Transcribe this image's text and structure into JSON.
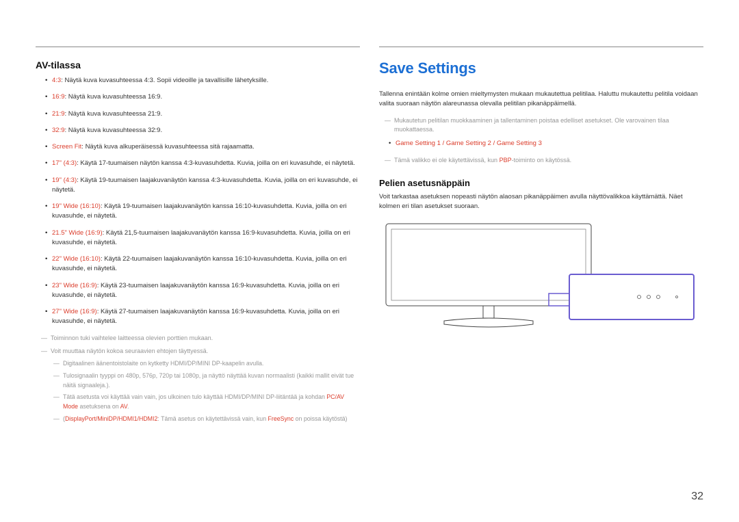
{
  "left": {
    "title": "AV-tilassa",
    "items": [
      {
        "term": "4:3",
        "rest": ": Näytä kuva kuvasuhteessa 4:3. Sopii videoille ja tavallisille lähetyksille."
      },
      {
        "term": "16:9",
        "rest": ": Näytä kuva kuvasuhteessa 16:9."
      },
      {
        "term": "21:9",
        "rest": ": Näytä kuva kuvasuhteessa 21:9."
      },
      {
        "term": "32:9",
        "rest": ": Näytä kuva kuvasuhteessa 32:9."
      },
      {
        "term": "Screen Fit",
        "rest": ": Näytä kuva alkuperäisessä kuvasuhteessa sitä rajaamatta."
      },
      {
        "term": "17\" (4:3)",
        "rest": ": Käytä 17-tuumaisen näytön kanssa 4:3-kuvasuhdetta. Kuvia, joilla on eri kuvasuhde, ei näytetä."
      },
      {
        "term": "19\" (4:3)",
        "rest": ": Käytä 19-tuumaisen laajakuvanäytön kanssa 4:3-kuvasuhdetta. Kuvia, joilla on eri kuvasuhde, ei näytetä."
      },
      {
        "term": "19\" Wide (16:10)",
        "rest": ": Käytä 19-tuumaisen laajakuvanäytön kanssa 16:10-kuvasuhdetta. Kuvia, joilla on eri kuvasuhde, ei näytetä."
      },
      {
        "term": "21.5\" Wide (16:9)",
        "rest": ": Käytä 21,5-tuumaisen laajakuvanäytön kanssa 16:9-kuvasuhdetta. Kuvia, joilla on eri kuvasuhde, ei näytetä."
      },
      {
        "term": "22\" Wide (16:10)",
        "rest": ": Käytä 22-tuumaisen laajakuvanäytön kanssa 16:10-kuvasuhdetta. Kuvia, joilla on eri kuvasuhde, ei näytetä."
      },
      {
        "term": "23\" Wide (16:9)",
        "rest": ": Käytä 23-tuumaisen laajakuvanäytön kanssa 16:9-kuvasuhdetta. Kuvia, joilla on eri kuvasuhde, ei näytetä."
      },
      {
        "term": "27\" Wide (16:9)",
        "rest": ": Käytä 27-tuumaisen laajakuvanäytön kanssa 16:9-kuvasuhdetta. Kuvia, joilla on eri kuvasuhde, ei näytetä."
      }
    ],
    "notes": {
      "n1": "Toiminnon tuki vaihtelee laitteessa olevien porttien mukaan.",
      "n2": "Voit muuttaa näytön kokoa seuraavien ehtojen täyttyessä.",
      "n2a": "Digitaalinen äänentoistolaite on kytketty HDMI/DP/MINI DP-kaapelin avulla.",
      "n2b": "Tulosignaalin tyyppi on 480p, 576p, 720p tai 1080p, ja näyttö näyttää kuvan normaalisti (kaikki mallit eivät tue näitä signaaleja.).",
      "n2c_a": "Tätä asetusta voi käyttää vain vain, jos ulkoinen tulo käyttää HDMI/DP/MINI DP-liitäntää ja kohdan ",
      "n2c_term": "PC/AV Mode",
      "n2c_mid": " asetuksena on ",
      "n2c_val": "AV",
      "n2c_end": ".",
      "n2d_pre": "(",
      "n2d_ports": "DisplayPort/MiniDP/HDMI1/HDMI2",
      "n2d_mid": ": Tämä asetus on käytettävissä vain, kun ",
      "n2d_term": "FreeSync",
      "n2d_end": " on poissa käytöstä)"
    }
  },
  "right": {
    "title": "Save Settings",
    "intro": "Tallenna enintään kolme omien mieltymysten mukaan mukautettua pelitilaa. Haluttu mukautettu pelitila voidaan valita suoraan näytön alareunassa olevalla pelitilan pikanäppäimellä.",
    "note1": "Mukautetun pelitilan muokkaaminen ja tallentaminen poistaa edelliset asetukset. Ole varovainen tilaa muokattaessa.",
    "bullet1": "Game Setting 1 / Game Setting 2 / Game Setting 3",
    "note2a": "Tämä valikko ei ole käytettävissä, kun ",
    "note2_term": "PBP",
    "note2b": "-toiminto on käytössä.",
    "sub": "Pelien asetusnäppäin",
    "subbody": "Voit tarkastaa asetuksen nopeasti näytön alaosan pikanäppäimen avulla näyttövalikkoa käyttämättä. Näet kolmen eri tilan asetukset suoraan."
  },
  "page_number": "32"
}
